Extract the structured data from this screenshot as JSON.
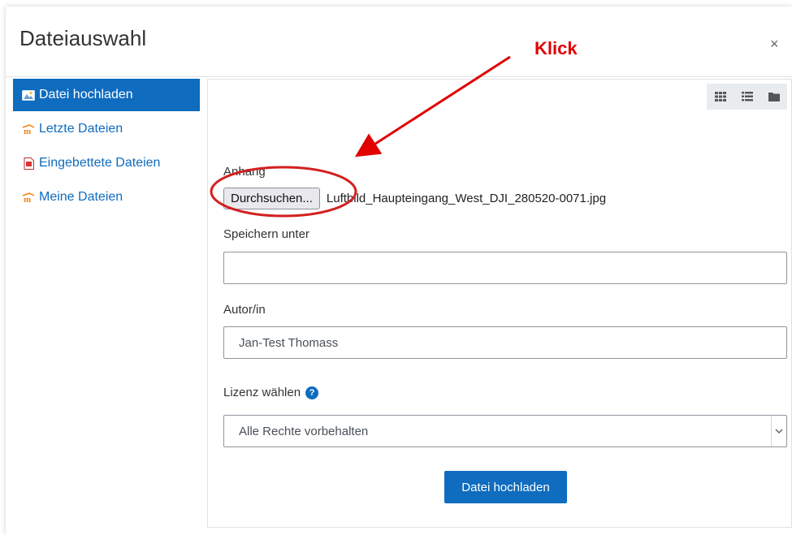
{
  "dialog": {
    "title": "Dateiauswahl",
    "close_label": "×"
  },
  "sidebar": {
    "items": [
      {
        "label": "Datei hochladen",
        "icon": "upload-image-icon"
      },
      {
        "label": "Letzte Dateien",
        "icon": "moodle-icon"
      },
      {
        "label": "Eingebettete Dateien",
        "icon": "document-icon"
      },
      {
        "label": "Meine Dateien",
        "icon": "moodle-icon"
      }
    ]
  },
  "viewbar": {
    "icons": [
      "grid-icon",
      "list-icon",
      "folder-icon"
    ]
  },
  "form": {
    "attachment_label": "Anhang",
    "browse_button": "Durchsuchen...",
    "file_name": "Luftbild_Haupteingang_West_DJI_280520-0071.jpg",
    "save_as_label": "Speichern unter",
    "save_as_value": "",
    "author_label": "Autor/in",
    "author_value": "Jan-Test Thomass",
    "license_label": "Lizenz wählen",
    "license_value": "Alle Rechte vorbehalten",
    "submit_button": "Datei hochladen"
  },
  "annotation": {
    "label": "Klick",
    "color": "#e00000"
  },
  "colors": {
    "accent": "#0f6cbf"
  }
}
